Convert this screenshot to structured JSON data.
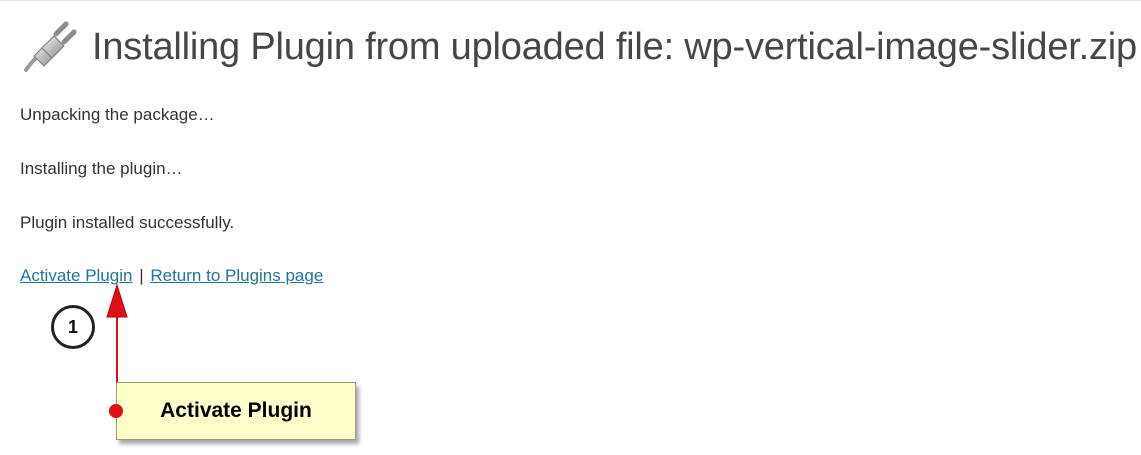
{
  "header": {
    "icon": "plugin-plug-icon",
    "title": "Installing Plugin from uploaded file: wp-vertical-image-slider.zip"
  },
  "messages": [
    "Unpacking the package…",
    "Installing the plugin…",
    "Plugin installed successfully."
  ],
  "actions": {
    "activate_label": "Activate Plugin",
    "separator": "|",
    "return_label": "Return to Plugins page",
    "link_color": "#21759b"
  },
  "annotation": {
    "step_number": "1",
    "callout_label": "Activate Plugin",
    "arrow_color": "#e0101a",
    "callout_color": "#ffffcc"
  }
}
